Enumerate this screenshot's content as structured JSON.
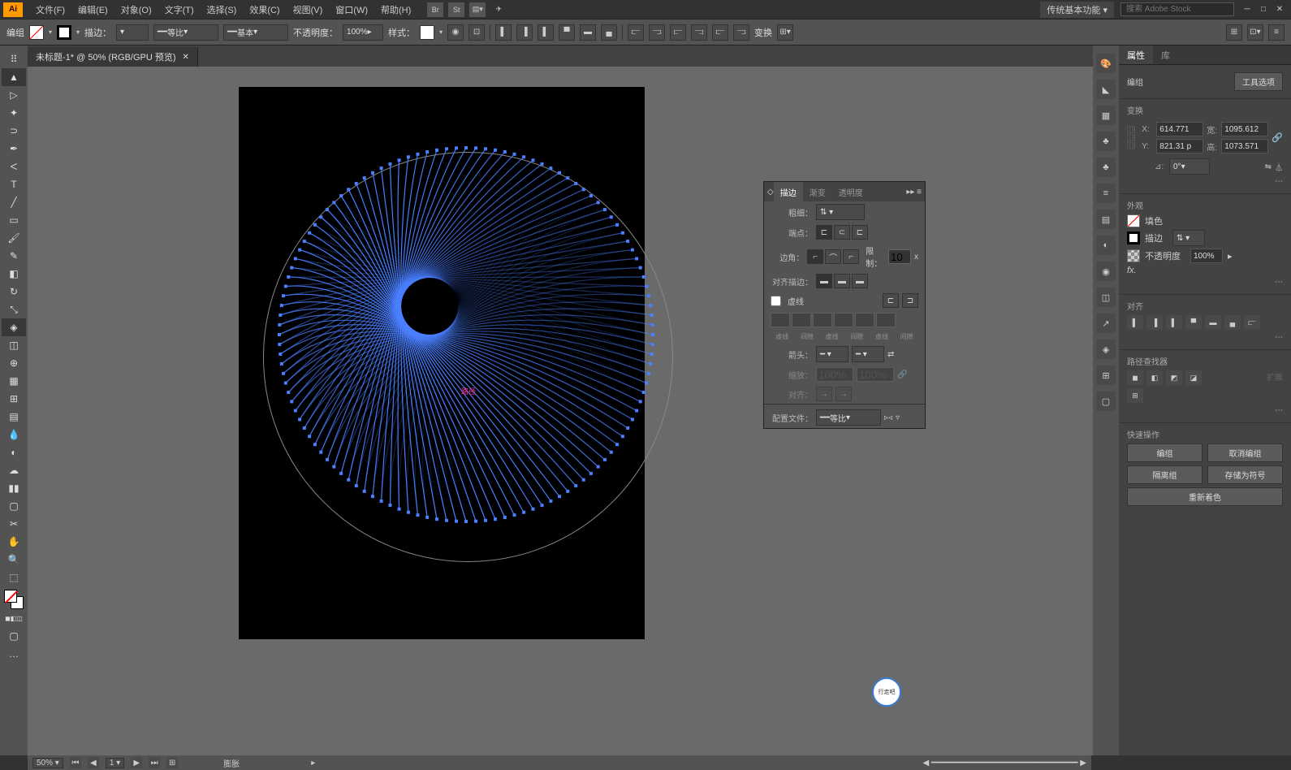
{
  "menubar": [
    "文件(F)",
    "编辑(E)",
    "对象(O)",
    "文字(T)",
    "选择(S)",
    "效果(C)",
    "视图(V)",
    "窗口(W)",
    "帮助(H)"
  ],
  "top_icons": [
    "Br",
    "St"
  ],
  "workspace": "传统基本功能",
  "search_placeholder": "搜索 Adobe Stock",
  "controlbar": {
    "mode": "编组",
    "stroke_label": "描边：",
    "stroke_pt": "",
    "profile1": "等比",
    "profile2": "基本",
    "opacity_label": "不透明度：",
    "opacity": "100%",
    "style_label": "样式：",
    "transform_label": "变换"
  },
  "tab": {
    "title": "未标题-1* @ 50% (RGB/GPU 预览)"
  },
  "canvas": {
    "center_label": "路径"
  },
  "statusbar": {
    "zoom": "50%",
    "page": "1",
    "status": "膨胀"
  },
  "stroke_panel": {
    "tabs": [
      "描边",
      "渐变",
      "透明度"
    ],
    "weight_lbl": "粗细：",
    "cap_lbl": "端点：",
    "corner_lbl": "边角：",
    "limit_lbl": "限制：",
    "limit_val": "10",
    "align_lbl": "对齐描边：",
    "dash_lbl": "虚线",
    "dash_cols": [
      "虚线",
      "间隙",
      "虚线",
      "间隙",
      "虚线",
      "间隙"
    ],
    "arrow_lbl": "箭头：",
    "scale_lbl": "缩放：",
    "scale1": "100%",
    "scale2": "100%",
    "align2_lbl": "对齐：",
    "profile_lbl": "配置文件：",
    "profile_val": "等比"
  },
  "props": {
    "tabs": [
      "属性",
      "库"
    ],
    "mode": "编组",
    "tool_opts": "工具选项",
    "transform_lbl": "变换",
    "x_lbl": "X:",
    "x": "614.771",
    "y_lbl": "Y:",
    "y": "821.31 p",
    "w_lbl": "宽:",
    "w": "1095.612",
    "h_lbl": "高:",
    "h": "1073.571",
    "angle_lbl": "⊿:",
    "angle": "0°",
    "appearance_lbl": "外观",
    "fill_lbl": "填色",
    "stroke_lbl": "描边",
    "opacity_lbl": "不透明度",
    "opacity": "100%",
    "fx": "fx.",
    "align_lbl": "对齐",
    "pathfinder_lbl": "路径查找器",
    "pf_expand": "扩展",
    "quick_lbl": "快速操作",
    "btn_group": "编组",
    "btn_ungroup": "取消编组",
    "btn_isolate": "隔离组",
    "btn_symbol": "存储为符号",
    "btn_recolor": "重新着色"
  },
  "watermark": "行走吧"
}
